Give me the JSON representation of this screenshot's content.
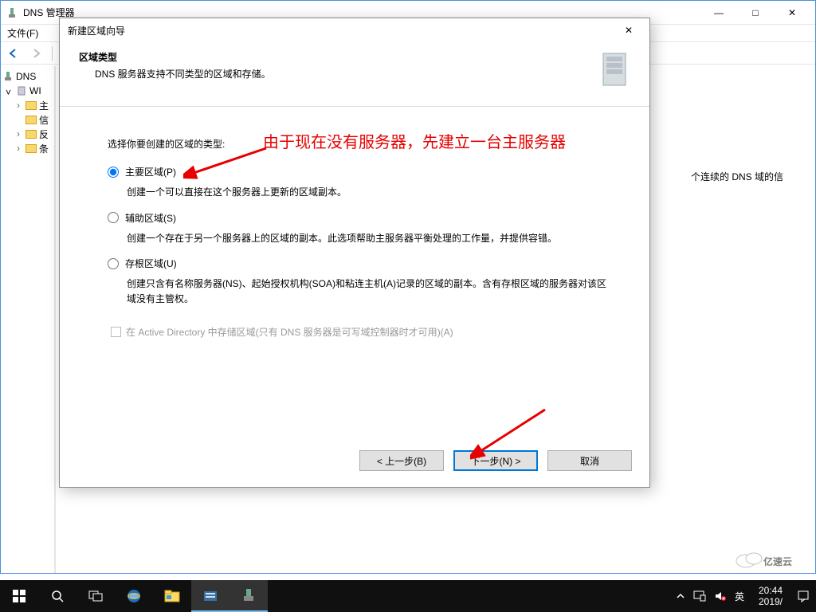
{
  "window": {
    "title": "DNS 管理器",
    "menu_file": "文件(F)",
    "sysbtn_min": "—",
    "sysbtn_max": "□",
    "sysbtn_close": "✕"
  },
  "tree": {
    "root": "DNS",
    "node1": "WI",
    "f1": "主",
    "f2": "信",
    "f3": "反",
    "f4": "条"
  },
  "content_hint": "个连续的 DNS 域的信",
  "dialog": {
    "title": "新建区域向导",
    "close": "✕",
    "header_title": "区域类型",
    "header_sub": "DNS 服务器支持不同类型的区域和存储。",
    "prompt": "选择你要创建的区域的类型:",
    "opt_primary_label": "主要区域(P)",
    "opt_primary_desc": "创建一个可以直接在这个服务器上更新的区域副本。",
    "opt_secondary_label": "辅助区域(S)",
    "opt_secondary_desc": "创建一个存在于另一个服务器上的区域的副本。此选项帮助主服务器平衡处理的工作量，并提供容错。",
    "opt_stub_label": "存根区域(U)",
    "opt_stub_desc": "创建只含有名称服务器(NS)、起始授权机构(SOA)和粘连主机(A)记录的区域的副本。含有存根区域的服务器对该区域没有主管权。",
    "ad_checkbox": "在 Active Directory 中存储区域(只有 DNS 服务器是可写域控制器时才可用)(A)",
    "btn_back": "< 上一步(B)",
    "btn_next": "下一步(N) >",
    "btn_cancel": "取消"
  },
  "annotation_text": "由于现在没有服务器，先建立一台主服务器",
  "taskbar": {
    "ime": "英",
    "time": "20:44",
    "date": "2019/"
  },
  "watermark": "亿速云"
}
